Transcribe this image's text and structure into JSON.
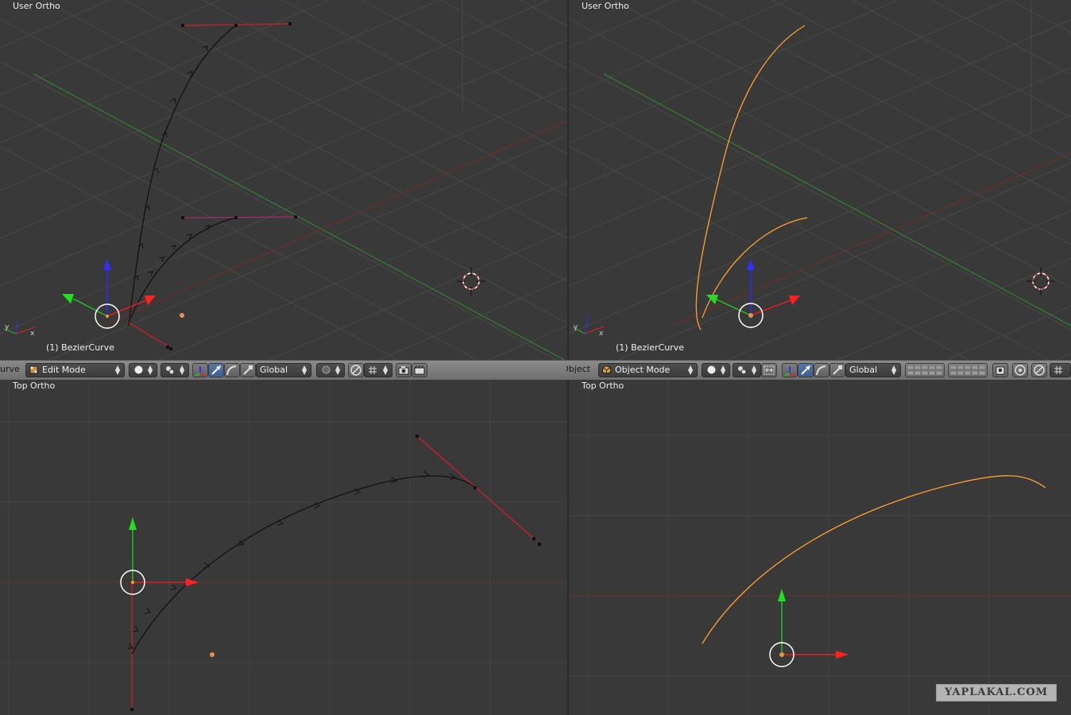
{
  "viewports": {
    "top_left": {
      "label": "User Ortho",
      "object_name": "(1) BezierCurve"
    },
    "top_right": {
      "label": "User Ortho",
      "object_name": "(1) BezierCurve"
    },
    "bottom_left": {
      "label": "Top Ortho"
    },
    "bottom_right": {
      "label": "Top Ortho"
    }
  },
  "headers": {
    "left": {
      "cut_text": "urve",
      "mode": "Edit Mode",
      "mode_icon": "edit-mode-icon",
      "orientation": "Global"
    },
    "right": {
      "cut_text": "Object",
      "mode": "Object Mode",
      "mode_icon": "object-mode-cube-icon",
      "orientation": "Global"
    }
  },
  "watermark": "YAPLAKAL.COM",
  "colors": {
    "background": "#393939",
    "grid": "#4a4a4a",
    "x_axis": "#ff2020",
    "y_axis": "#20e020",
    "z_axis": "#3030ff",
    "curve_selected": "#ffa030",
    "handle": "#e03030"
  }
}
